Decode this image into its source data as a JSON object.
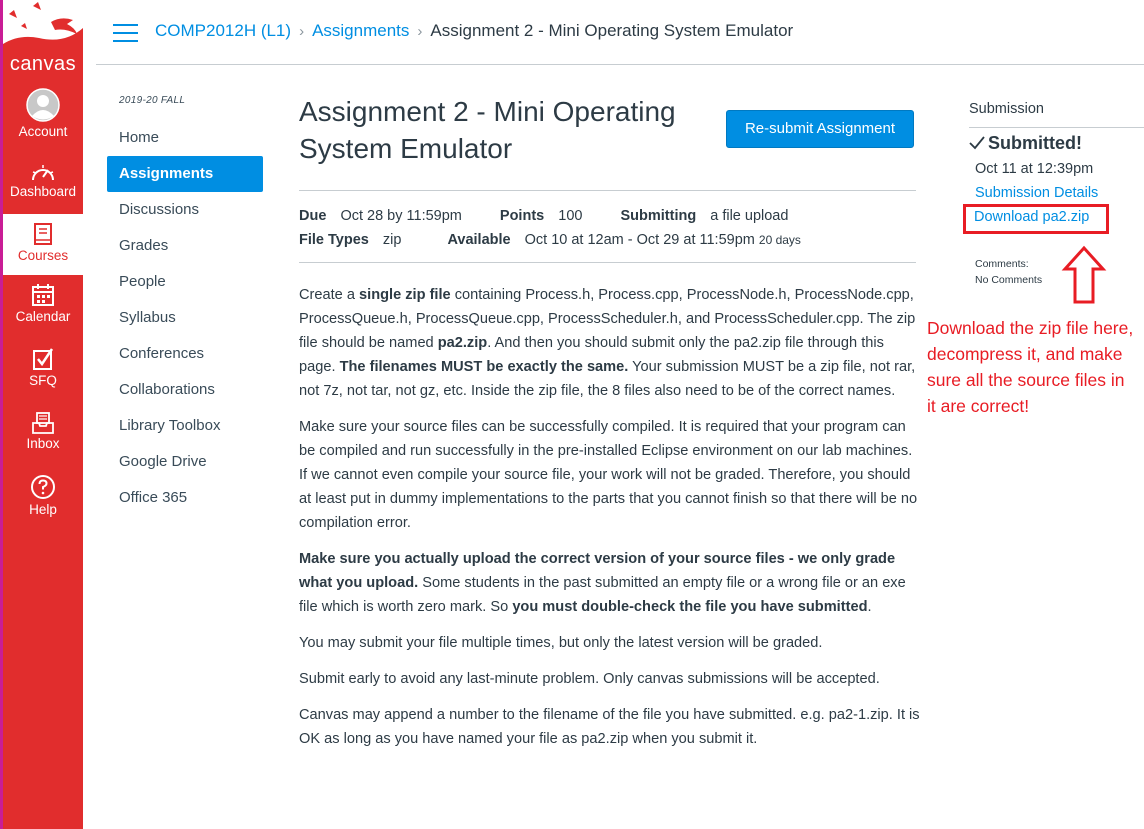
{
  "global_nav": {
    "logo_text": "canvas",
    "items": [
      {
        "label": "Account"
      },
      {
        "label": "Dashboard"
      },
      {
        "label": "Courses"
      },
      {
        "label": "Calendar"
      },
      {
        "label": "SFQ"
      },
      {
        "label": "Inbox"
      },
      {
        "label": "Help"
      }
    ],
    "colors": {
      "nav_bg": "#e12d2d",
      "accent": "#008ee2"
    }
  },
  "breadcrumb": {
    "course": "COMP2012H (L1)",
    "section": "Assignments",
    "current": "Assignment 2 - Mini Operating System Emulator",
    "separator": "›"
  },
  "course_nav": {
    "term": "2019-20 FALL",
    "items": [
      {
        "label": "Home"
      },
      {
        "label": "Assignments"
      },
      {
        "label": "Discussions"
      },
      {
        "label": "Grades"
      },
      {
        "label": "People"
      },
      {
        "label": "Syllabus"
      },
      {
        "label": "Conferences"
      },
      {
        "label": "Collaborations"
      },
      {
        "label": "Library Toolbox"
      },
      {
        "label": "Google Drive"
      },
      {
        "label": "Office 365"
      }
    ]
  },
  "assignment": {
    "title": "Assignment 2 - Mini Operating System Emulator",
    "resubmit_label": "Re-submit Assignment",
    "details": {
      "due_label": "Due",
      "due_value": "Oct 28 by 11:59pm",
      "points_label": "Points",
      "points_value": "100",
      "submitting_label": "Submitting",
      "submitting_value": "a file upload",
      "filetypes_label": "File Types",
      "filetypes_value": "zip",
      "available_label": "Available",
      "available_value": "Oct 10 at 12am - Oct 29 at 11:59pm",
      "available_days": "20 days"
    },
    "description": {
      "p1": {
        "t1": "Create a ",
        "b1": "single zip file",
        "t2": " containing Process.h, Process.cpp, ProcessNode.h, ProcessNode.cpp, ProcessQueue.h, ProcessQueue.cpp, ProcessScheduler.h, and ProcessScheduler.cpp. The zip file should be named ",
        "b2": "pa2.zip",
        "t3": ". And then you should submit only the pa2.zip file through this page. ",
        "b3": "The filenames MUST be exactly the same.",
        "t4": " Your submission MUST be a zip file, not rar, not 7z, not tar, not gz, etc. Inside the zip file, the 8 files also need to be of the correct names."
      },
      "p2": "Make sure your source files can be successfully compiled. It is required that your program can be compiled and run successfully in the pre-installed Eclipse environment on our lab machines. If we cannot even compile your source file, your work will not be graded. Therefore, you should at least put in dummy implementations to the parts that you cannot finish so that there will be no compilation error.",
      "p3": {
        "b1": "Make sure you actually upload the correct version of your source files - we only grade what you upload.",
        "t1": " Some students in the past submitted an empty file or a wrong file or an exe file which is worth zero mark. So ",
        "b2": "you must double-check the file you have submitted",
        "t2": "."
      },
      "p4": "You may submit your file multiple times, but only the latest version will be graded.",
      "p5": "Submit early to avoid any last-minute problem. Only canvas submissions will be accepted.",
      "p6": "Canvas may append a number to the filename of the file you have submitted. e.g. pa2-1.zip. It is OK as long as you have named your file as pa2.zip when you submit it."
    }
  },
  "submission": {
    "heading": "Submission",
    "status": "Submitted!",
    "date": "Oct 11 at 12:39pm",
    "details_link": "Submission Details",
    "download_link": "Download pa2.zip",
    "comments_label": "Comments:",
    "comments_value": "No Comments"
  },
  "annotation": {
    "text": "Download the zip file here, decompress it, and make sure all the source files in it are correct!",
    "color": "#e81c24"
  }
}
